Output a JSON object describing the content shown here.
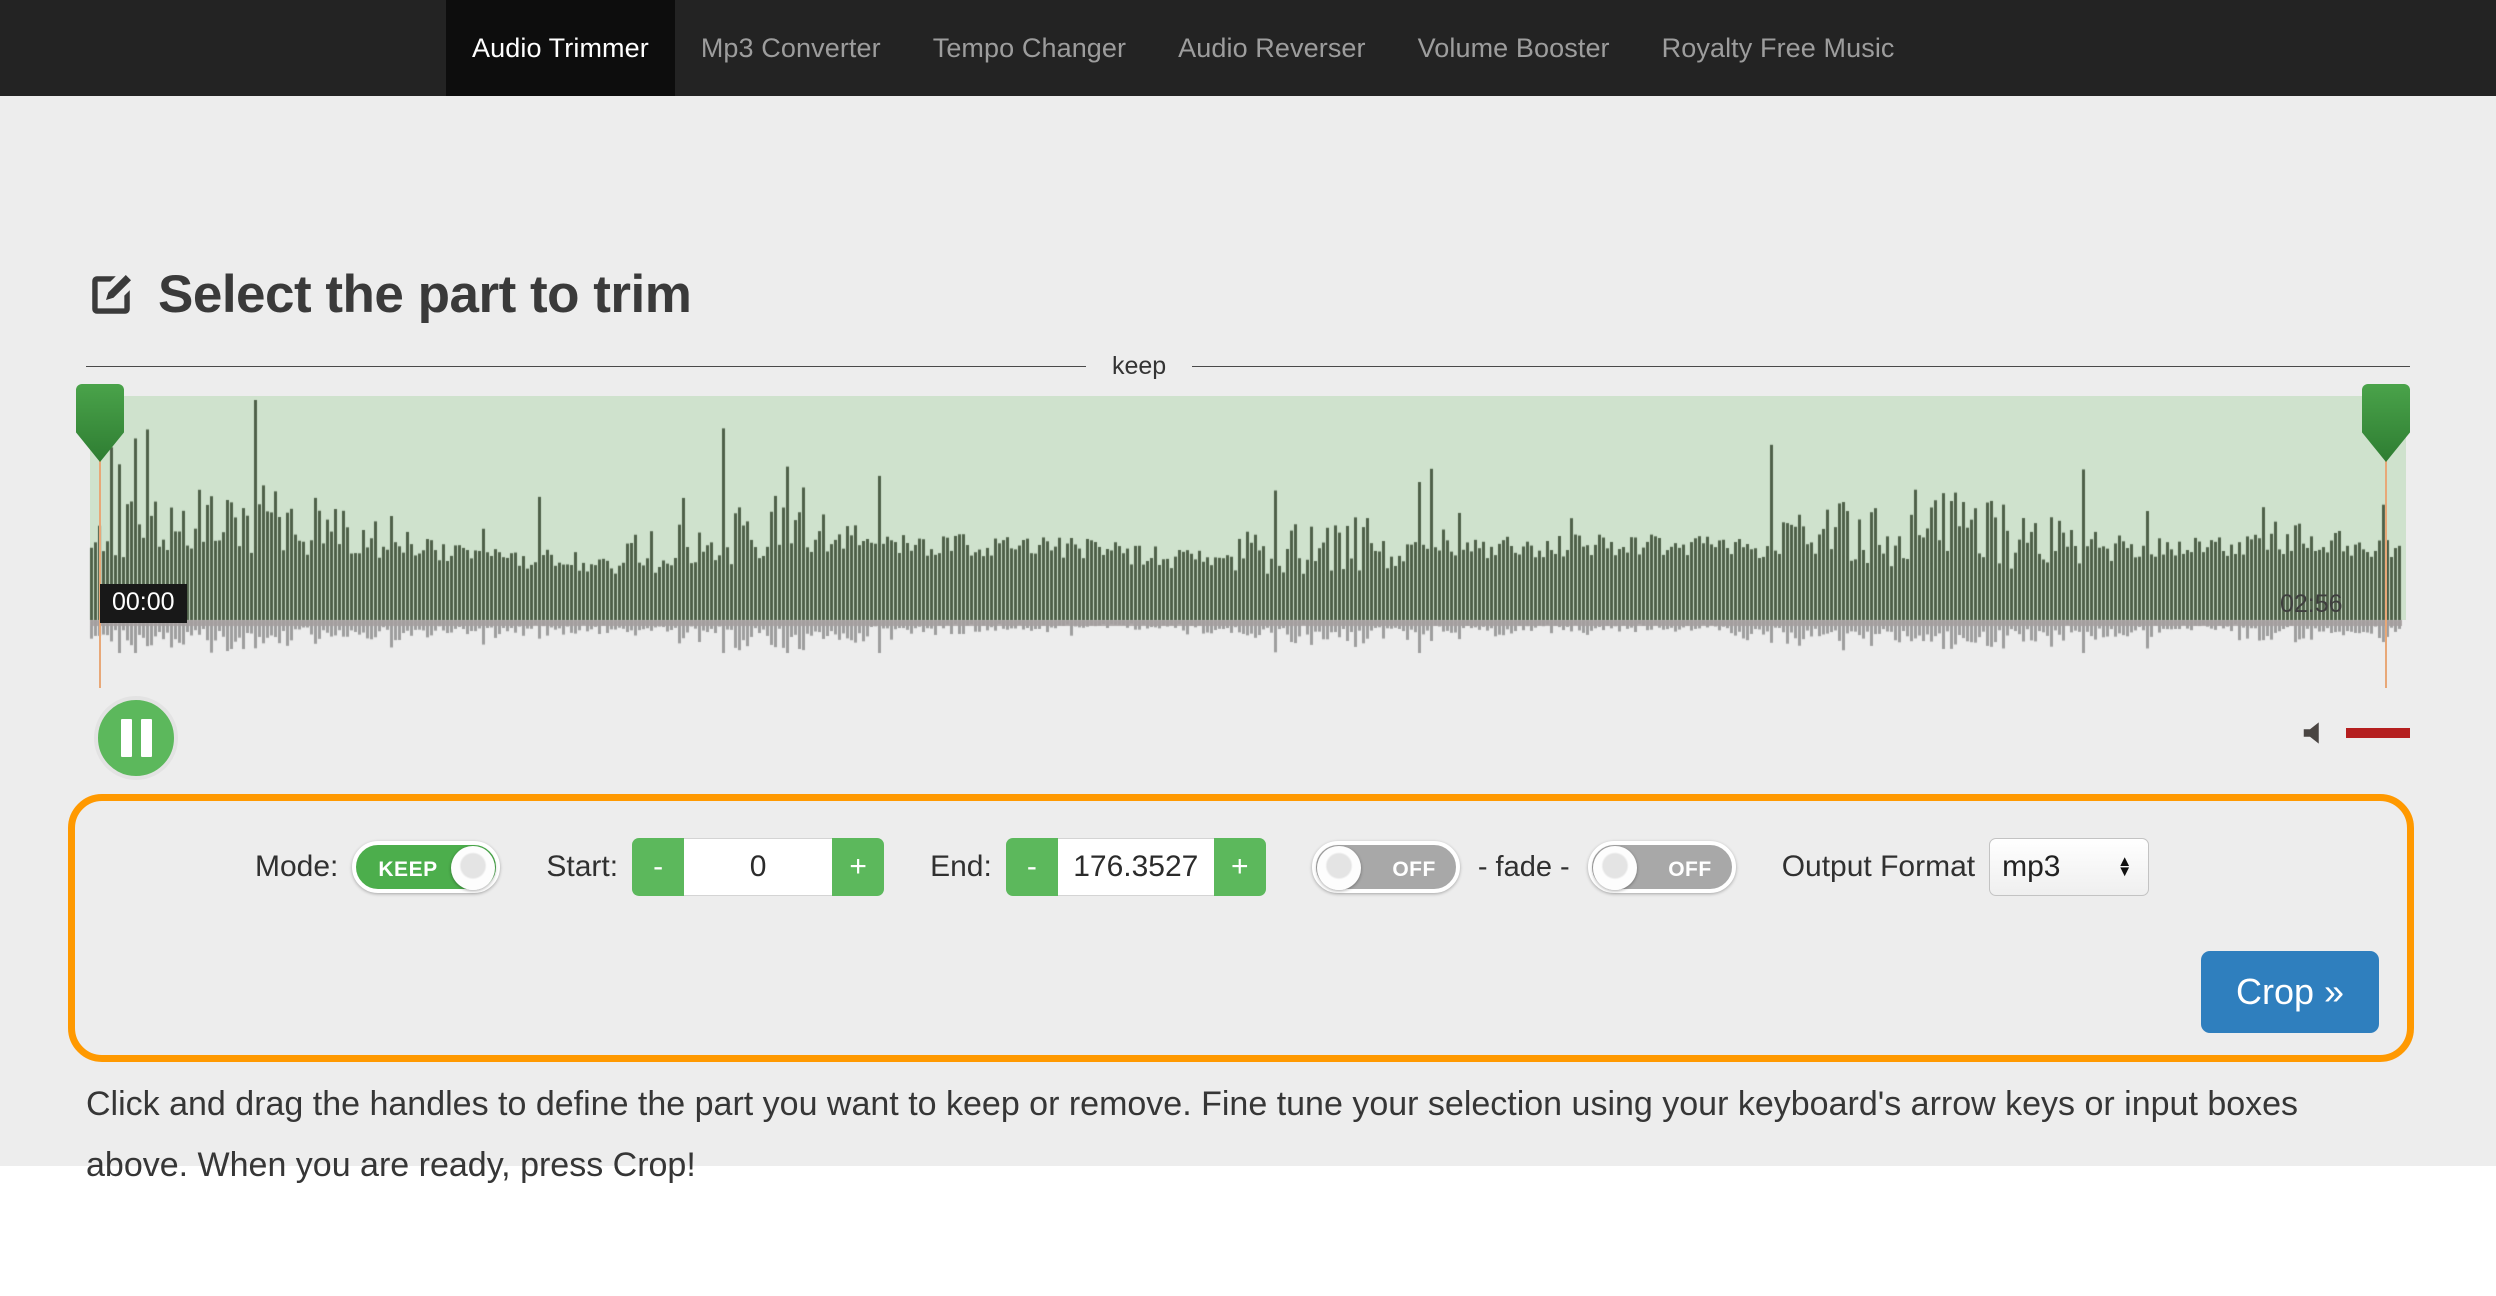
{
  "nav": {
    "tabs": [
      {
        "label": "Audio Trimmer",
        "active": true
      },
      {
        "label": "Mp3 Converter",
        "active": false
      },
      {
        "label": "Tempo Changer",
        "active": false
      },
      {
        "label": "Audio Reverser",
        "active": false
      },
      {
        "label": "Volume Booster",
        "active": false
      },
      {
        "label": "Royalty Free Music",
        "active": false
      }
    ]
  },
  "header": {
    "title": "Select the part to trim",
    "icon": "edit-square-icon"
  },
  "waveform": {
    "section_label": "keep",
    "start_time": "00:00",
    "end_time": "02:56",
    "selection_bg_color": "#cfe2cd",
    "wave_color": "#4f6149",
    "reflection_color": "#9e9e9e",
    "handle_color": "#2e7d32"
  },
  "transport": {
    "play_state": "pause-icon",
    "volume_icon": "speaker-icon",
    "volume_color": "#b51f1f"
  },
  "options": {
    "mode_label": "Mode:",
    "mode_value": "KEEP",
    "mode_on": true,
    "start_label": "Start:",
    "start_minus": "-",
    "start_value": "0",
    "start_plus": "+",
    "end_label": "End:",
    "end_minus": "-",
    "end_value": "176.3527",
    "end_plus": "+",
    "fade_in_value": "OFF",
    "fade_text": "- fade -",
    "fade_out_value": "OFF",
    "format_label": "Output Format",
    "format_value": "mp3",
    "crop_label": "Crop »",
    "panel_border_color": "#ff9900",
    "crop_color": "#2f7fbe"
  },
  "instructions": {
    "text": "Click and drag the handles to define the part you want to keep or remove. Fine tune your selection using your keyboard's arrow keys or input boxes above. When you are ready, press Crop!"
  }
}
